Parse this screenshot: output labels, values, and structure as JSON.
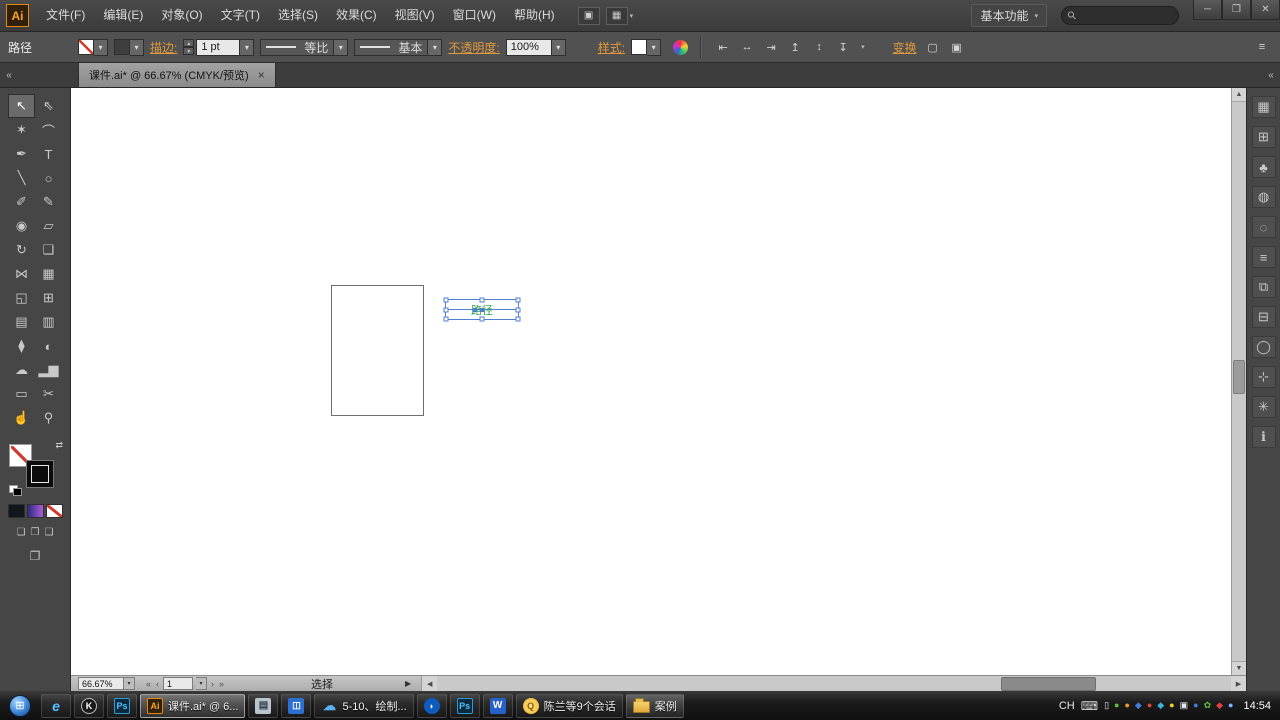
{
  "colors": {
    "selection_blue": "#4f7fce",
    "text_green": "#2ea052",
    "link_orange": "#e0993f",
    "ai_orange": "#f9a22b"
  },
  "icons": {
    "dd": "▾",
    "up": "▴",
    "v_up": "▲",
    "v_down": "▼",
    "h_left": "◀",
    "h_right": "▶",
    "popup": "▶",
    "collapse": "«",
    "panel_menu": "≡",
    "search": "⚲",
    "swap": "⇄"
  },
  "menubar": {
    "logo": "Ai",
    "menus": [
      "文件(F)",
      "编辑(E)",
      "对象(O)",
      "文字(T)",
      "选择(S)",
      "效果(C)",
      "视图(V)",
      "窗口(W)",
      "帮助(H)"
    ],
    "doc_icon": "▣",
    "arrange_icon": "▦",
    "workspace": "基本功能",
    "search_value": "",
    "window_controls": {
      "minimize": "─",
      "restore": "❐",
      "close": "✕"
    }
  },
  "controlbar": {
    "object_label": "路径",
    "stroke_link": "描边:",
    "stroke_width": "1 pt",
    "profile_value": "等比",
    "brush_value": "基本",
    "opacity_link": "不透明度:",
    "opacity_value": "100%",
    "style_link": "样式:",
    "transform_link": "变换",
    "align_icons": [
      {
        "name": "align-left-icon",
        "glyph": "⇤"
      },
      {
        "name": "align-center-horizontal-icon",
        "glyph": "↔"
      },
      {
        "name": "align-right-icon",
        "glyph": "⇥"
      },
      {
        "name": "align-top-icon",
        "glyph": "↥"
      },
      {
        "name": "align-middle-icon",
        "glyph": "↕"
      },
      {
        "name": "align-bottom-icon",
        "glyph": "↧"
      }
    ],
    "extra_icons": [
      {
        "name": "isolate-icon",
        "glyph": "▢"
      },
      {
        "name": "select-similar-icon",
        "glyph": "▣"
      }
    ]
  },
  "tabbar": {
    "tab_title": "课件.ai* @ 66.67% (CMYK/预览)",
    "close_glyph": "×"
  },
  "tools": [
    {
      "name": "selection-tool",
      "glyph": "↖",
      "state": "active"
    },
    {
      "name": "direct-selection-tool",
      "glyph": "⇖"
    },
    {
      "name": "magic-wand-tool",
      "glyph": "✶"
    },
    {
      "name": "lasso-tool",
      "glyph": "⌒"
    },
    {
      "name": "pen-tool",
      "glyph": "✒"
    },
    {
      "name": "type-tool",
      "glyph": "T"
    },
    {
      "name": "line-tool",
      "glyph": "╲"
    },
    {
      "name": "ellipse-tool",
      "glyph": "○"
    },
    {
      "name": "paintbrush-tool",
      "glyph": "✐"
    },
    {
      "name": "pencil-tool",
      "glyph": "✎"
    },
    {
      "name": "blob-brush-tool",
      "glyph": "◉"
    },
    {
      "name": "eraser-tool",
      "glyph": "▱"
    },
    {
      "name": "rotate-tool",
      "glyph": "↻"
    },
    {
      "name": "scale-tool",
      "glyph": "❏"
    },
    {
      "name": "width-tool",
      "glyph": "⋈"
    },
    {
      "name": "free-transform-tool",
      "glyph": "▦"
    },
    {
      "name": "shape-builder-tool",
      "glyph": "◱"
    },
    {
      "name": "perspective-grid-tool",
      "glyph": "⊞"
    },
    {
      "name": "mesh-tool",
      "glyph": "▤"
    },
    {
      "name": "gradient-tool",
      "glyph": "▥"
    },
    {
      "name": "eyedropper-tool",
      "glyph": "⧫"
    },
    {
      "name": "blend-tool",
      "glyph": "◐"
    },
    {
      "name": "symbol-sprayer-tool",
      "glyph": "☁"
    },
    {
      "name": "column-graph-tool",
      "glyph": "▂▆"
    },
    {
      "name": "artboard-tool",
      "glyph": "▭"
    },
    {
      "name": "slice-tool",
      "glyph": "✂"
    },
    {
      "name": "hand-tool",
      "glyph": "☝"
    },
    {
      "name": "zoom-tool",
      "glyph": "⚲"
    }
  ],
  "panel_icons": [
    {
      "name": "panel-color",
      "glyph": "▦"
    },
    {
      "name": "panel-color-guide",
      "glyph": "⊞"
    },
    {
      "name": "panel-brushes",
      "glyph": "♣"
    },
    {
      "name": "panel-symbols",
      "glyph": "◍"
    },
    {
      "name": "panel-transparency",
      "glyph": "◌"
    },
    {
      "name": "panel-stroke",
      "glyph": "≡"
    },
    {
      "name": "panel-layers",
      "glyph": "⧉"
    },
    {
      "name": "panel-artboards",
      "glyph": "⊟"
    },
    {
      "name": "panel-appearance",
      "glyph": "◯"
    },
    {
      "name": "panel-align",
      "glyph": "⊹"
    },
    {
      "name": "panel-pathfinder",
      "glyph": "✳"
    },
    {
      "name": "panel-info",
      "glyph": "ℹ"
    }
  ],
  "canvas": {
    "selected_text": "路径"
  },
  "statusbar": {
    "zoom_value": "66.67%",
    "nav": {
      "first": "«",
      "prev": "‹",
      "next": "›",
      "last": "»"
    },
    "page_value": "1",
    "status_text": "选择"
  },
  "taskbar": {
    "start_glyph": "⊞",
    "items": [
      {
        "name": "task-ie",
        "icon_text": "e",
        "cls": "ic-ie"
      },
      {
        "name": "task-kugou",
        "icon_text": "K",
        "cls": "ic-k"
      },
      {
        "name": "task-photoshop",
        "icon_text": "Ps",
        "cls": "ic-ps"
      },
      {
        "name": "task-illustrator",
        "icon_text": "Ai",
        "cls": "ic-ai",
        "label": "课件.ai* @ 6...",
        "state": "active"
      },
      {
        "name": "task-notepad",
        "icon_text": "▤",
        "cls": "ic-note"
      },
      {
        "name": "task-im",
        "icon_text": "◫",
        "cls": "ic-blue"
      },
      {
        "name": "task-video-player",
        "icon_text": "☁",
        "cls": "ic-cloud",
        "label": "5-10、绘制..."
      },
      {
        "name": "task-thunder",
        "icon_text": "◗",
        "cls": "ic-thunder"
      },
      {
        "name": "task-photoshop-2",
        "icon_text": "Ps",
        "cls": "ic-ps"
      },
      {
        "name": "task-w-app",
        "icon_text": "W",
        "cls": "ic-w"
      },
      {
        "name": "task-qq-sessions",
        "icon_text": "Q",
        "cls": "ic-qq",
        "label": "陈兰等9个会话"
      },
      {
        "name": "task-folder-anli",
        "icon_text": "",
        "cls": "ic-folder",
        "label": "案例",
        "state": "lit"
      }
    ],
    "tray": {
      "language": "CH",
      "keyboard_glyph": "⌨",
      "icons": [
        {
          "glyph": "▯",
          "cls": "c-white"
        },
        {
          "glyph": "●",
          "cls": "c-green"
        },
        {
          "glyph": "●",
          "cls": "c-orange"
        },
        {
          "glyph": "◆",
          "cls": "c-blue"
        },
        {
          "glyph": "●",
          "cls": "c-red"
        },
        {
          "glyph": "◆",
          "cls": "c-cyan"
        },
        {
          "glyph": "●",
          "cls": "c-yellow"
        },
        {
          "glyph": "▣",
          "cls": "c-white"
        },
        {
          "glyph": "●",
          "cls": "c-blue"
        },
        {
          "glyph": "✿",
          "cls": "c-green"
        },
        {
          "glyph": "◆",
          "cls": "c-red"
        },
        {
          "glyph": "●",
          "cls": "c-lblue"
        }
      ],
      "time": "14:54"
    }
  }
}
